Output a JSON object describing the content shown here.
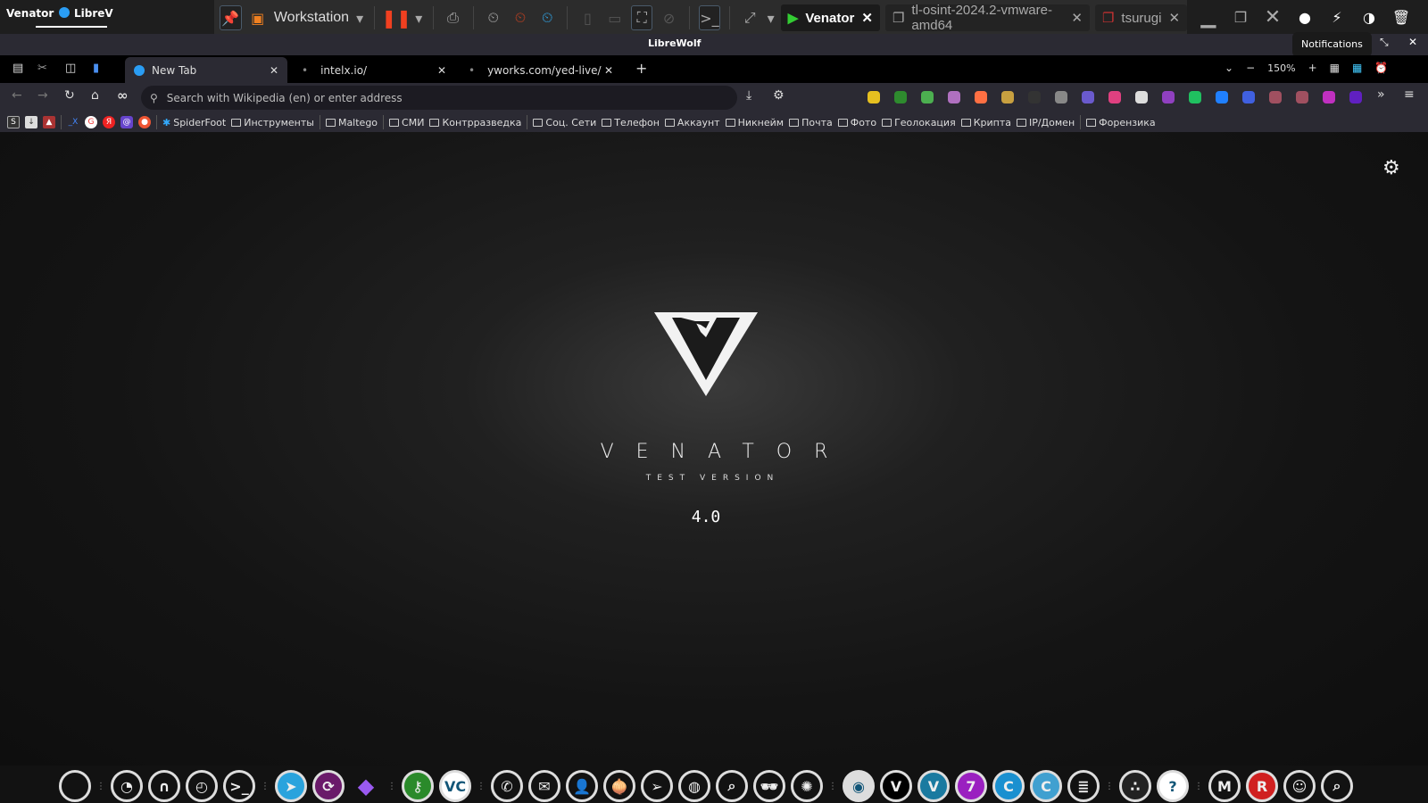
{
  "system_bar": {
    "app_name": "Venator",
    "browser_tab": "LibreV"
  },
  "vmware": {
    "product": "Workstation",
    "tabs": [
      {
        "label": "Venator",
        "active": true
      },
      {
        "label": "tl-osint-2024.2-vmware-amd64",
        "active": false
      },
      {
        "label": "tsurugi",
        "active": false
      }
    ]
  },
  "window": {
    "title": "LibreWolf",
    "tooltip": "Notifications"
  },
  "browser": {
    "tabs": [
      {
        "label": "New Tab",
        "active": true
      },
      {
        "label": "intelx.io/"
      },
      {
        "label": "yworks.com/yed-live/"
      }
    ],
    "address_placeholder": "Search with Wikipedia (en) or enter address",
    "zoom": "150%",
    "bookmarks": [
      "SpiderFoot",
      "Инструменты",
      "Maltego",
      "СМИ",
      "Контрразведка",
      "Соц. Сети",
      "Телефон",
      "Аккаунт",
      "Никнейм",
      "Почта",
      "Фото",
      "Геолокация",
      "Крипта",
      "IP/Домен",
      "Форензика"
    ],
    "extension_colors": [
      "#e6c020",
      "#2e8b2e",
      "#4caf50",
      "#b070c0",
      "#ff7043",
      "#c8a040",
      "#333333",
      "#888888",
      "#6a5acd",
      "#e04080",
      "#dddddd",
      "#9040c0",
      "#20c060",
      "#2080ff",
      "#4060e0",
      "#a05060",
      "#a05060",
      "#c030c0",
      "#6020c0"
    ]
  },
  "page": {
    "brand": "VENATOR",
    "subtitle": "TEST VERSION",
    "version": "4.0"
  },
  "taskbar": {
    "icons": [
      "circle",
      "clock",
      "graph",
      "speedometer",
      "terminal",
      "telegram",
      "sync",
      "obsidian",
      "keepass",
      "veracrypt",
      "phone",
      "mail",
      "user",
      "tor",
      "send",
      "globe",
      "image-search",
      "incognito",
      "neural",
      "chrome",
      "venator-black",
      "venator-blue",
      "venator-purple",
      "c-app",
      "c-scroll",
      "database",
      "dots",
      "detective",
      "maltego",
      "redhat",
      "portrait",
      "search-doc"
    ]
  }
}
